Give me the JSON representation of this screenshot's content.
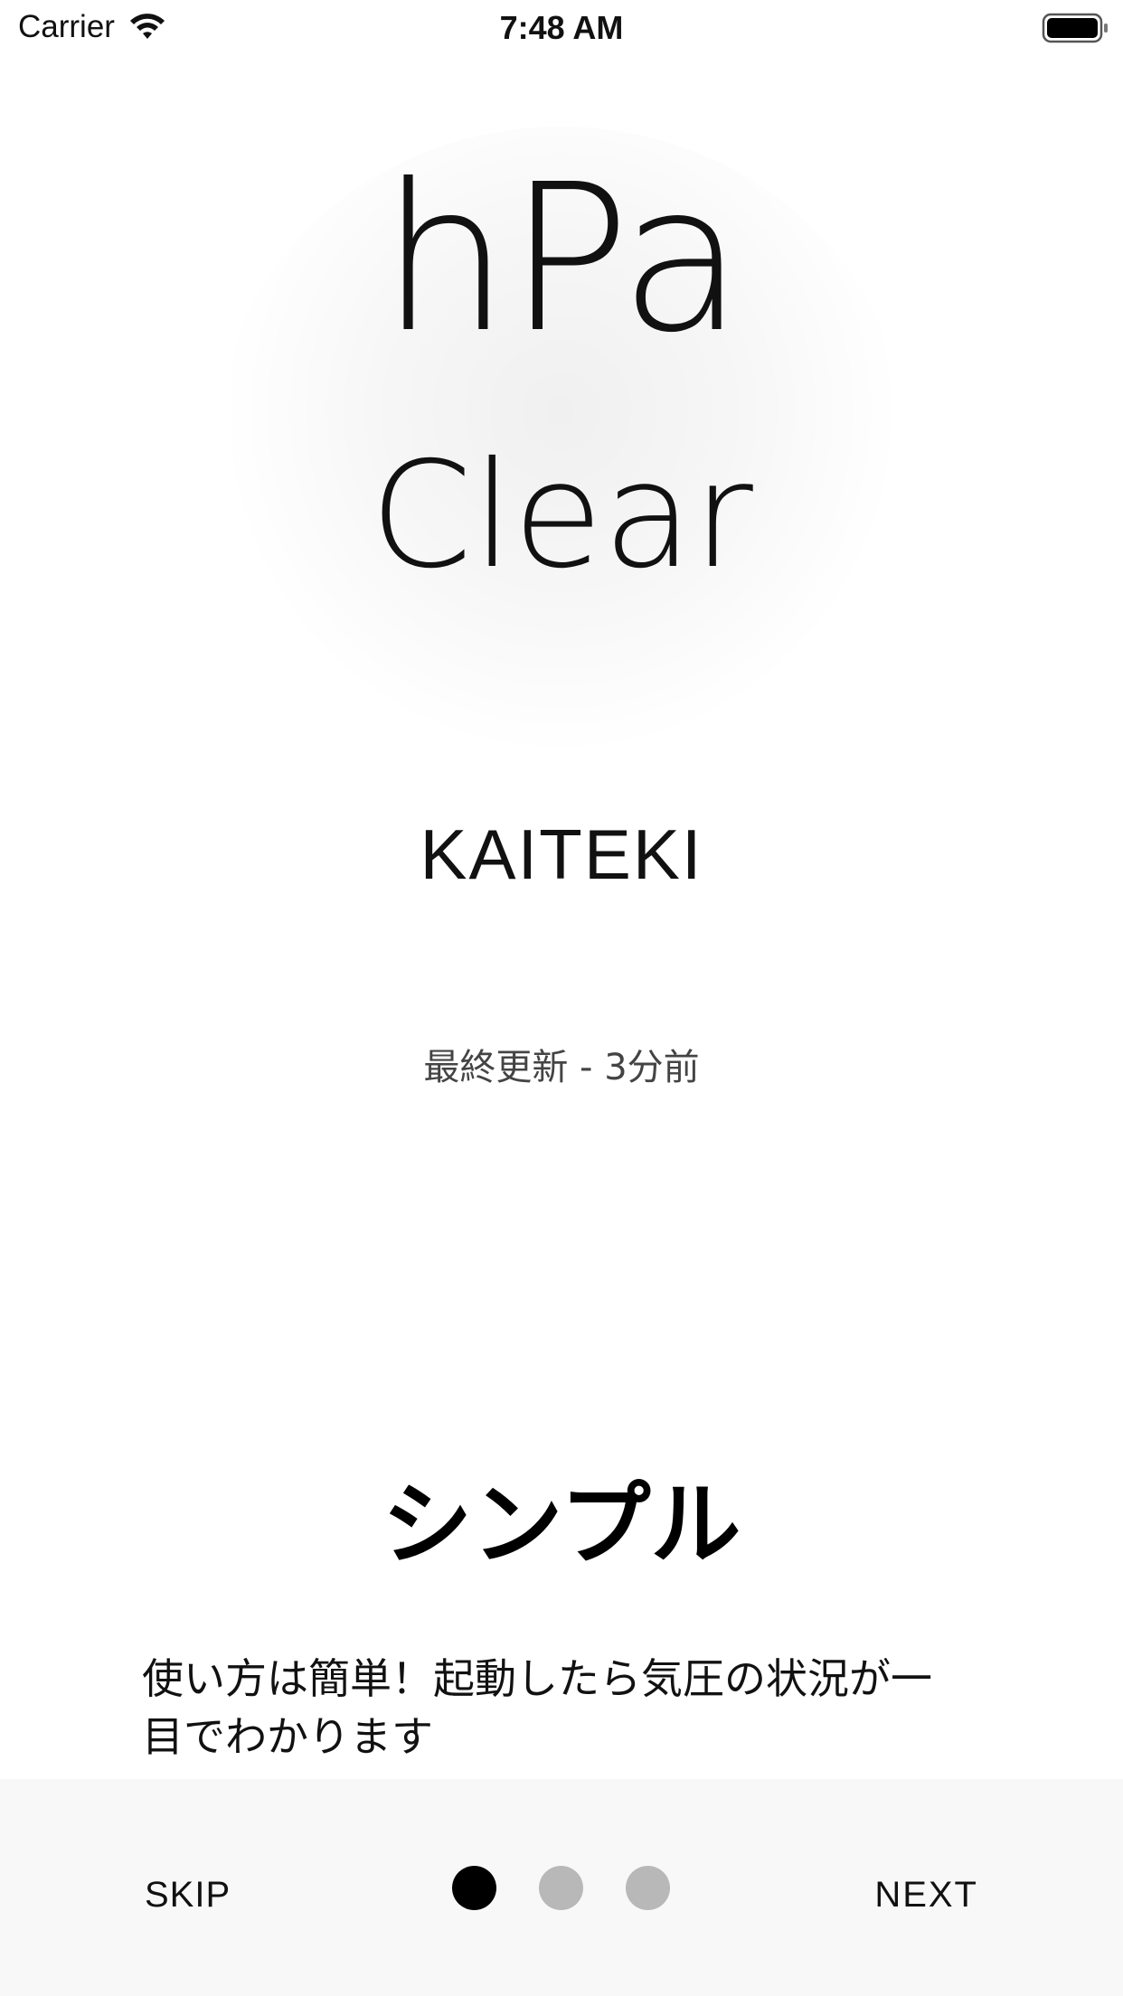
{
  "status_bar": {
    "carrier": "Carrier",
    "time": "7:48 AM",
    "icons": [
      "wifi-icon",
      "battery-icon"
    ]
  },
  "hero": {
    "unit": "hPa",
    "weather": "Clear",
    "status_word": "KAITEKI",
    "last_updated": "最終更新 - 3分前"
  },
  "onboarding": {
    "title": "シンプル",
    "description_line1": "使い方は簡単！起動したら気圧の状況が一",
    "description_line2": "目でわかります",
    "current_page": 1,
    "total_pages": 3
  },
  "bottom_bar": {
    "skip_label": "SKIP",
    "next_label": "NEXT"
  },
  "colors": {
    "active_dot": "#000000",
    "inactive_dot": "#b8b8b8",
    "bottom_bar_bg": "#f8f8f8"
  }
}
